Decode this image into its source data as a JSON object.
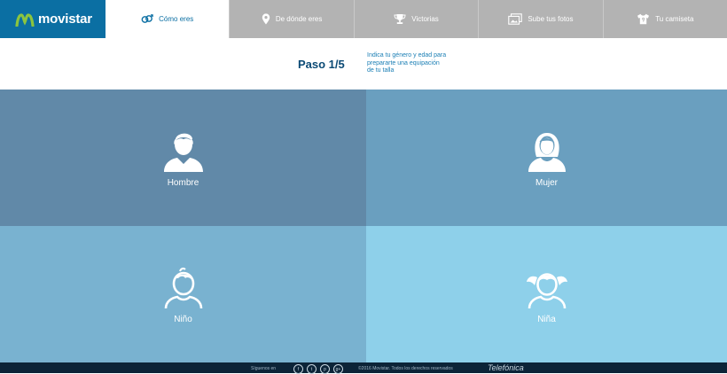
{
  "nav": {
    "brand": "movistar",
    "tabs": [
      {
        "label": "Cómo eres",
        "icon": "gender-icon",
        "active": true
      },
      {
        "label": "De dónde eres",
        "icon": "location-pin-icon",
        "active": false
      },
      {
        "label": "Victorias",
        "icon": "trophy-icon",
        "active": false
      },
      {
        "label": "Sube tus fotos",
        "icon": "photos-icon",
        "active": false
      },
      {
        "label": "Tu camiseta",
        "icon": "shirt-icon",
        "active": false
      }
    ]
  },
  "step": {
    "title": "Paso 1/5",
    "description": "Indica tu género y edad para prepararte una equipación de tu talla"
  },
  "options": [
    {
      "label": "Hombre",
      "icon": "man-avatar-icon",
      "color": "#6189a8"
    },
    {
      "label": "Mujer",
      "icon": "woman-avatar-icon",
      "color": "#6a9fbf"
    },
    {
      "label": "Niño",
      "icon": "boy-avatar-icon",
      "color": "#79b2d0"
    },
    {
      "label": "Niña",
      "icon": "girl-avatar-icon",
      "color": "#8ed0ea"
    }
  ],
  "footer": {
    "follow": "Síguenos en",
    "social": [
      "f",
      "t",
      "p",
      "g+"
    ],
    "copyright": "©2016 Movistar. Todos los derechos reservados",
    "telefonica": "Telefónica"
  },
  "colors": {
    "brand": "#0b6fa3",
    "nav_inactive": "#b3b3b3",
    "footer": "#0c2438"
  }
}
